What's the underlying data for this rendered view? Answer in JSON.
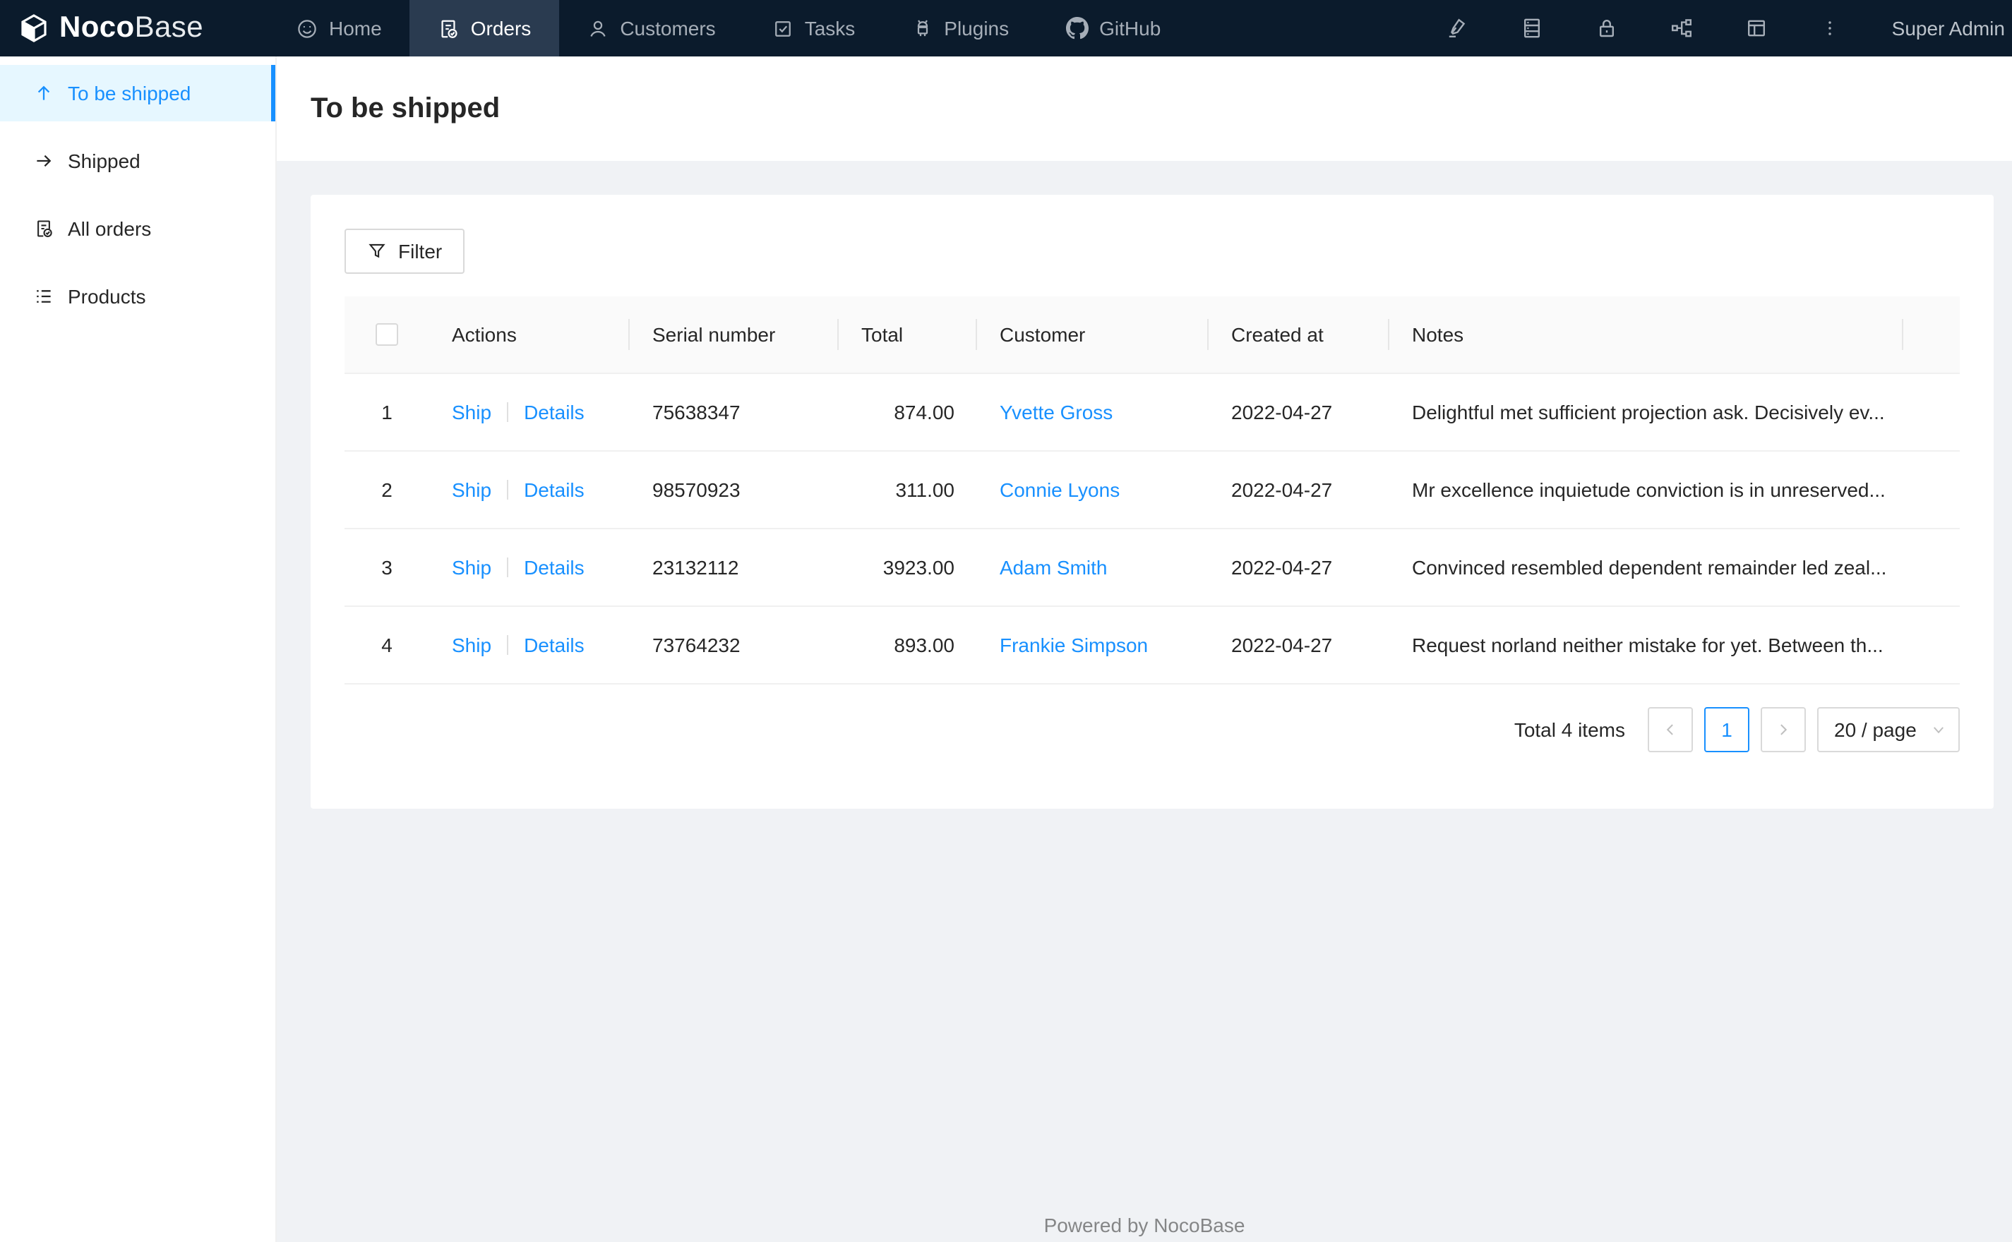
{
  "colors": {
    "accent": "#1890ff",
    "navbar_bg": "#0b1b2c",
    "navbar_active_bg": "#2a3b50",
    "sidebar_active_bg": "#e6f7ff",
    "content_bg": "#f0f2f5",
    "link": "#1890ff",
    "table_header_bg": "#fafafa"
  },
  "navbar": {
    "logo": {
      "primary": "Noco",
      "secondary": "Base"
    },
    "items": [
      {
        "label": "Home",
        "icon": "smile-icon",
        "active": false
      },
      {
        "label": "Orders",
        "icon": "file-done-icon",
        "active": true
      },
      {
        "label": "Customers",
        "icon": "user-icon",
        "active": false
      },
      {
        "label": "Tasks",
        "icon": "check-square-icon",
        "active": false
      },
      {
        "label": "Plugins",
        "icon": "android-icon",
        "active": false
      },
      {
        "label": "GitHub",
        "icon": "github-icon",
        "active": false
      }
    ],
    "right_icons": [
      "highlighter-icon",
      "database-icon",
      "lock-icon",
      "apartment-icon",
      "layout-icon",
      "kebab-menu-icon"
    ],
    "user": "Super Admin"
  },
  "sidebar": {
    "items": [
      {
        "label": "To be shipped",
        "icon": "arrow-up-icon",
        "active": true
      },
      {
        "label": "Shipped",
        "icon": "arrow-right-icon",
        "active": false
      },
      {
        "label": "All orders",
        "icon": "file-done-icon",
        "active": false
      },
      {
        "label": "Products",
        "icon": "list-icon",
        "active": false
      }
    ]
  },
  "page": {
    "title": "To be shipped"
  },
  "toolbar": {
    "filter_label": "Filter"
  },
  "table": {
    "columns": [
      "Actions",
      "Serial number",
      "Total",
      "Customer",
      "Created at",
      "Notes"
    ],
    "row_actions": {
      "ship": "Ship",
      "details": "Details"
    },
    "rows": [
      {
        "index": "1",
        "serial": "75638347",
        "total": "874.00",
        "customer": "Yvette Gross",
        "created_at": "2022-04-27",
        "notes": "Delightful met sufficient projection ask. Decisively ev..."
      },
      {
        "index": "2",
        "serial": "98570923",
        "total": "311.00",
        "customer": "Connie Lyons",
        "created_at": "2022-04-27",
        "notes": "Mr excellence inquietude conviction is in unreserved..."
      },
      {
        "index": "3",
        "serial": "23132112",
        "total": "3923.00",
        "customer": "Adam Smith",
        "created_at": "2022-04-27",
        "notes": "Convinced resembled dependent remainder led zeal..."
      },
      {
        "index": "4",
        "serial": "73764232",
        "total": "893.00",
        "customer": "Frankie Simpson",
        "created_at": "2022-04-27",
        "notes": "Request norland neither mistake for yet. Between th..."
      }
    ]
  },
  "pagination": {
    "total_text": "Total 4 items",
    "current_page": "1",
    "page_size_label": "20 / page"
  },
  "footer": {
    "text": "Powered by NocoBase"
  }
}
